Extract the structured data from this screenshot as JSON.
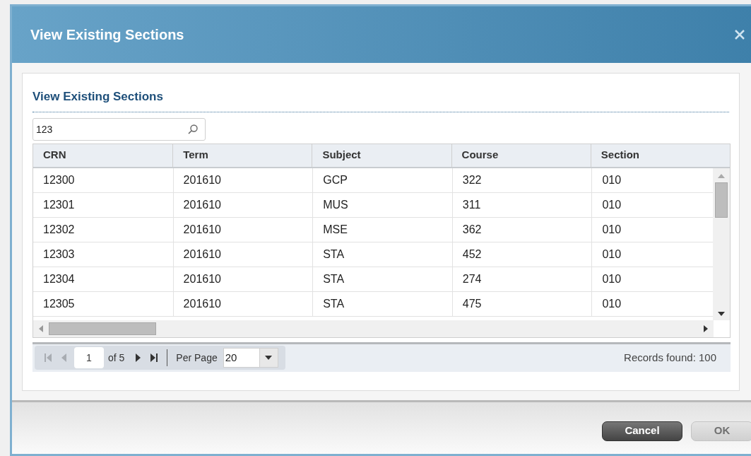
{
  "window": {
    "title": "View Existing Sections"
  },
  "panel": {
    "heading": "View Existing Sections"
  },
  "search": {
    "value": "123"
  },
  "table": {
    "columns": [
      "CRN",
      "Term",
      "Subject",
      "Course",
      "Section"
    ],
    "rows": [
      [
        "12300",
        "201610",
        "GCP",
        "322",
        "010"
      ],
      [
        "12301",
        "201610",
        "MUS",
        "311",
        "010"
      ],
      [
        "12302",
        "201610",
        "MSE",
        "362",
        "010"
      ],
      [
        "12303",
        "201610",
        "STA",
        "452",
        "010"
      ],
      [
        "12304",
        "201610",
        "STA",
        "274",
        "010"
      ],
      [
        "12305",
        "201610",
        "STA",
        "475",
        "010"
      ]
    ]
  },
  "pager": {
    "buttons": [
      {
        "kind": "first",
        "disabled": true
      },
      {
        "kind": "prev",
        "disabled": true
      }
    ],
    "page": "1",
    "of": "of 5",
    "buttons_after": [
      {
        "kind": "next",
        "disabled": false
      },
      {
        "kind": "last",
        "disabled": false
      }
    ],
    "per_page_label": "Per Page",
    "per_page": "20",
    "records": "Records found: 100"
  },
  "buttons": [
    {
      "label": "Cancel",
      "disabled": false
    },
    {
      "label": "OK",
      "disabled": true
    }
  ]
}
